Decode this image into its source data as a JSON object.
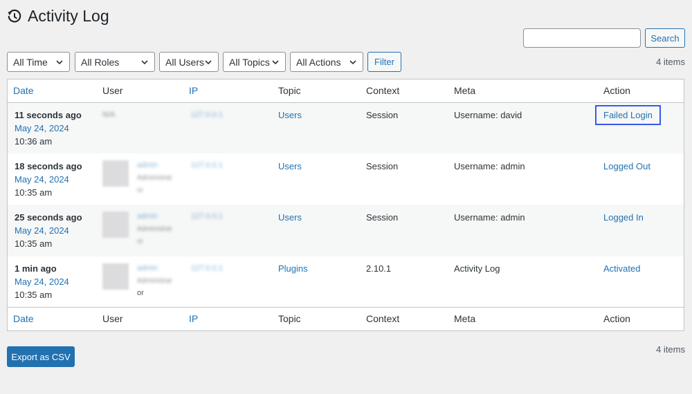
{
  "page": {
    "title": "Activity Log"
  },
  "search": {
    "value": "",
    "button": "Search"
  },
  "filters": [
    {
      "label": "All Time"
    },
    {
      "label": "All Roles"
    },
    {
      "label": "All Users"
    },
    {
      "label": "All Topics"
    },
    {
      "label": "All Actions"
    }
  ],
  "filter_button": "Filter",
  "count_top": "4 items",
  "count_bottom": "4 items",
  "columns": {
    "date": "Date",
    "user": "User",
    "ip": "IP",
    "topic": "Topic",
    "context": "Context",
    "meta": "Meta",
    "action": "Action"
  },
  "rows": [
    {
      "ago": "11 seconds ago",
      "date": "May 24, 2024",
      "time": "10:36 am",
      "user": "N/A",
      "user_role": "",
      "user_role2": "",
      "ip": "127.0.0.1",
      "topic": "Users",
      "context": "Session",
      "meta": "Username: david",
      "action": "Failed Login"
    },
    {
      "ago": "18 seconds ago",
      "date": "May 24, 2024",
      "time": "10:35 am",
      "user": "admin",
      "user_role": "Administrat",
      "user_role2": "or",
      "ip": "127.0.0.1",
      "topic": "Users",
      "context": "Session",
      "meta": "Username: admin",
      "action": "Logged Out"
    },
    {
      "ago": "25 seconds ago",
      "date": "May 24, 2024",
      "time": "10:35 am",
      "user": "admin",
      "user_role": "Administrat",
      "user_role2": "or",
      "ip": "127.0.0.1",
      "topic": "Users",
      "context": "Session",
      "meta": "Username: admin",
      "action": "Logged In"
    },
    {
      "ago": "1 min ago",
      "date": "May 24, 2024",
      "time": "10:35 am",
      "user": "admin",
      "user_role": "Administrat",
      "user_role2": "or",
      "ip": "127.0.0.1",
      "topic": "Plugins",
      "context": "2.10.1",
      "meta": "Activity Log",
      "action": "Activated"
    }
  ],
  "export_button": "Export as CSV",
  "colors": {
    "link": "#2271b1",
    "highlight": "#3858e9",
    "primary": "#2271b1"
  }
}
